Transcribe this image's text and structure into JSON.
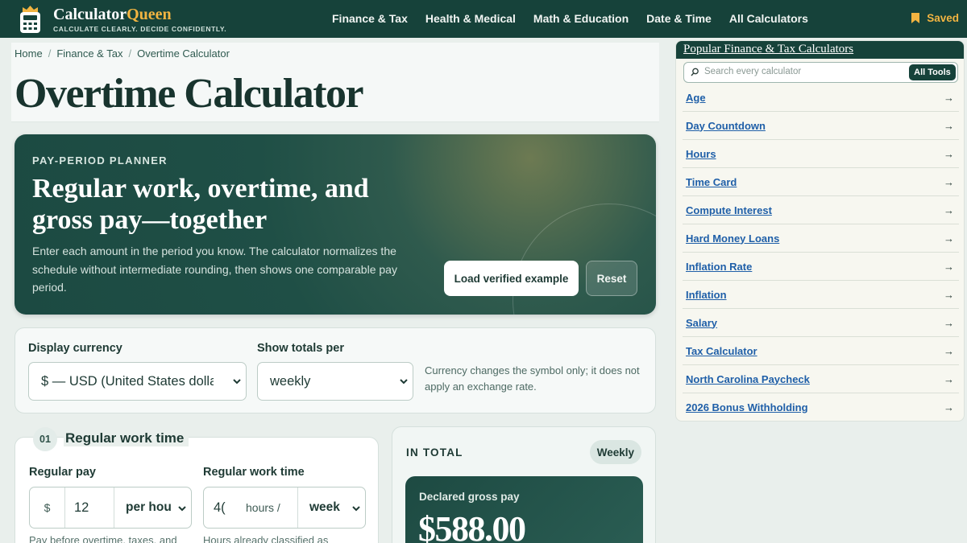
{
  "brand": {
    "name_main": "Calculator",
    "name_accent": "Queen",
    "tagline": "CALCULATE CLEARLY. DECIDE CONFIDENTLY."
  },
  "nav": {
    "items": [
      "Finance & Tax",
      "Health & Medical",
      "Math & Education",
      "Date & Time",
      "All Calculators"
    ],
    "saved_label": "Saved"
  },
  "breadcrumb": [
    "Home",
    "Finance & Tax",
    "Overtime Calculator"
  ],
  "page_title": "Overtime Calculator",
  "hero": {
    "eyebrow": "PAY-PERIOD PLANNER",
    "headline": "Regular work, overtime, and gross pay—together",
    "description": "Enter each amount in the period you know. The calculator normalizes the schedule without intermediate rounding, then shows one comparable pay period.",
    "example_button": "Load verified example",
    "reset_button": "Reset"
  },
  "settings": {
    "currency_label": "Display currency",
    "currency_value": "$ — USD (United States dolla",
    "totals_label": "Show totals per",
    "totals_value": "weekly",
    "note": "Currency changes the symbol only; it does not apply an exchange rate."
  },
  "regular_work": {
    "step": "01",
    "title": "Regular work time",
    "pay_label": "Regular pay",
    "pay_prefix": "$",
    "pay_value": "12",
    "pay_unit": "per hou",
    "pay_help": "Pay before overtime, taxes, and",
    "time_label": "Regular work time",
    "time_value": "4(",
    "time_suffix": "hours /",
    "time_unit": "week",
    "time_help": "Hours already classified as"
  },
  "total": {
    "label": "IN TOTAL",
    "period": "Weekly",
    "gross_label": "Declared gross pay",
    "gross_value": "$588.00"
  },
  "sidebar": {
    "title": "Popular Finance & Tax Calculators",
    "search_placeholder": "Search every calculator",
    "all_tools": "All Tools",
    "items": [
      {
        "label": "Age"
      },
      {
        "label": "Day Countdown"
      },
      {
        "label": "Hours"
      },
      {
        "label": "Time Card"
      },
      {
        "label": "Compute Interest"
      },
      {
        "label": "Hard Money Loans"
      },
      {
        "label": "Inflation Rate"
      },
      {
        "label": "Inflation"
      },
      {
        "label": "Salary"
      },
      {
        "label": "Tax Calculator"
      },
      {
        "label": "North Carolina Paycheck"
      },
      {
        "label": "2026 Bonus Withholding"
      }
    ],
    "arrow": "→"
  },
  "colors": {
    "header_bg": "#16423a",
    "accent_gold": "#f2b441",
    "link_blue": "#1f5fa8"
  }
}
